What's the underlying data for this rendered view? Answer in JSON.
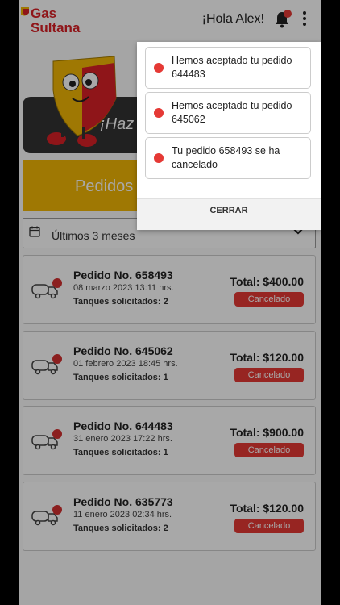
{
  "header": {
    "logo_line1": "Gas",
    "logo_line2": "Sultana",
    "greeting": "¡Hola Alex!"
  },
  "banner": {
    "text": "¡Haz"
  },
  "tabs": {
    "pedidos": "Pedidos"
  },
  "filter": {
    "label": "Últimos 3 meses"
  },
  "orders": [
    {
      "number": "Pedido No. 658493",
      "date": "08 marzo 2023 13:11 hrs.",
      "tanks": "Tanques solicitados: 2",
      "total": "Total: $400.00",
      "status": "Cancelado"
    },
    {
      "number": "Pedido No. 645062",
      "date": "01 febrero 2023 18:45 hrs.",
      "tanks": "Tanques solicitados: 1",
      "total": "Total: $120.00",
      "status": "Cancelado"
    },
    {
      "number": "Pedido No. 644483",
      "date": "31 enero 2023 17:22 hrs.",
      "tanks": "Tanques solicitados: 1",
      "total": "Total: $900.00",
      "status": "Cancelado"
    },
    {
      "number": "Pedido No. 635773",
      "date": "11 enero 2023 02:34 hrs.",
      "tanks": "Tanques solicitados: 2",
      "total": "Total: $120.00",
      "status": "Cancelado"
    }
  ],
  "notifications": {
    "items": [
      {
        "text": "Hemos aceptado tu pedido 644483"
      },
      {
        "text": "Hemos aceptado tu pedido 645062"
      },
      {
        "text": "Tu pedido 658493 se ha cancelado"
      }
    ],
    "close_label": "CERRAR"
  },
  "colors": {
    "brand_red": "#d92027",
    "brand_yellow": "#f2b705",
    "status_red": "#e53935"
  }
}
